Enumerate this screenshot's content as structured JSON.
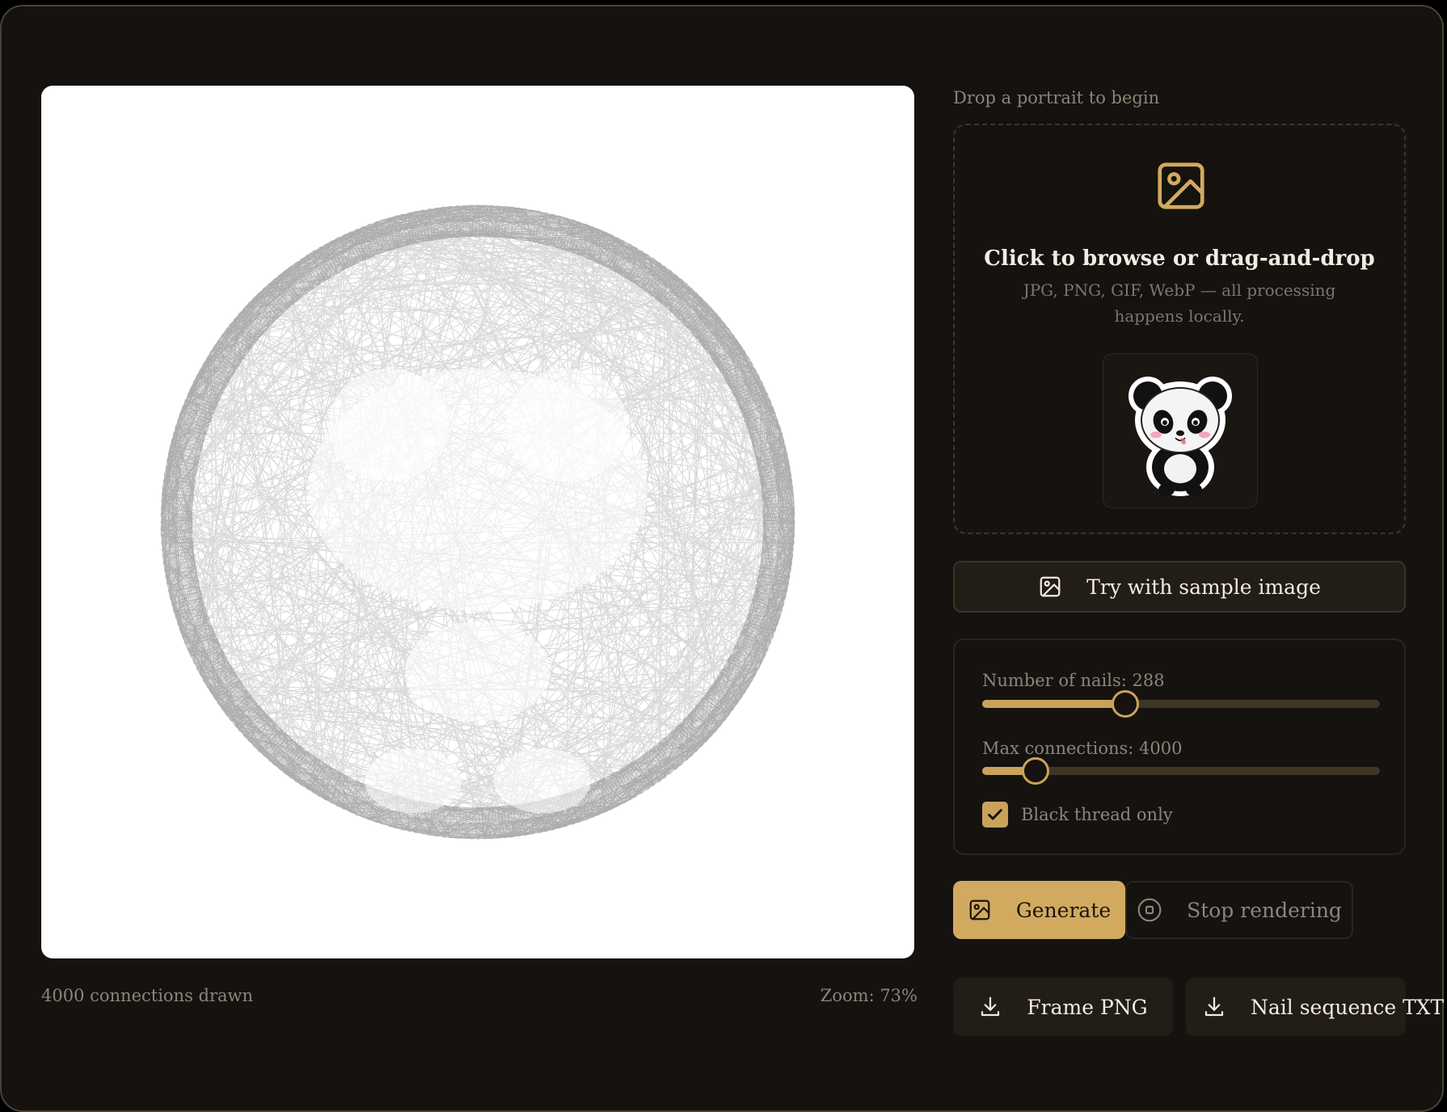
{
  "canvas": {
    "status_text": "4000 connections drawn",
    "zoom_text": "Zoom: 73%"
  },
  "upload": {
    "hint": "Drop a portrait to begin",
    "title": "Click to browse or drag-and-drop",
    "subtitle": "JPG, PNG, GIF, WebP — all processing happens locally.",
    "icon": "image-icon",
    "preview_alt": "panda-sticker"
  },
  "sample_button": {
    "label": "Try with sample image",
    "icon": "image-icon"
  },
  "settings": {
    "nails": {
      "label": "Number of nails: 288",
      "value": 288,
      "fill_fraction": 0.36
    },
    "connections": {
      "label": "Max connections: 4000",
      "value": 4000,
      "fill_fraction": 0.135
    },
    "black_thread": {
      "label": "Black thread only",
      "checked": true
    }
  },
  "actions": {
    "generate_label": "Generate",
    "stop_label": "Stop rendering",
    "download_png_label": "Frame PNG",
    "download_txt_label": "Nail sequence TXT"
  },
  "colors": {
    "background": "#151210",
    "accent": "#d2aa5f",
    "muted_text": "#8d8577"
  }
}
